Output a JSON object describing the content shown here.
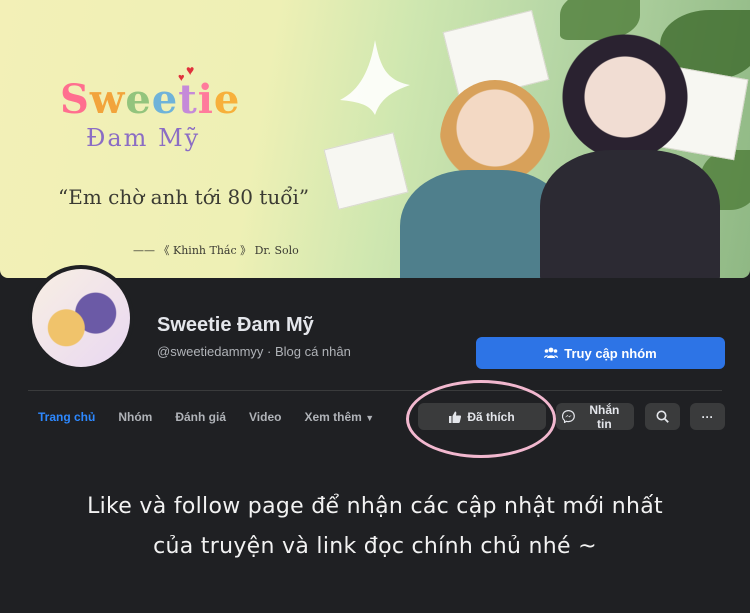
{
  "cover": {
    "brand_letters": [
      "S",
      "w",
      "e",
      "e",
      "t",
      "i",
      "e"
    ],
    "brand_sub": "Đam Mỹ",
    "quote": "“Em chờ anh tới 80 tuổi”",
    "credit": "—— 《 Khinh Thác 》 Dr. Solo"
  },
  "profile": {
    "name": "Sweetie Đam Mỹ",
    "handle": "@sweetiedammyy · Blog cá nhân",
    "primary_button": "Truy cập nhóm"
  },
  "nav": {
    "tabs": [
      "Trang chủ",
      "Nhóm",
      "Đánh giá",
      "Video",
      "Xem thêm"
    ],
    "active": "Trang chủ"
  },
  "actions": {
    "liked": "Đã thích",
    "message": "Nhắn tin",
    "more": "···"
  },
  "note": {
    "line1": "Like và follow page để nhận các cập nhật mới nhất",
    "line2": "của truyện và link đọc chính chủ nhé ~"
  },
  "colors": {
    "accent": "#2d74e6",
    "ring": "#f2b8cf",
    "background": "#1f2023"
  }
}
